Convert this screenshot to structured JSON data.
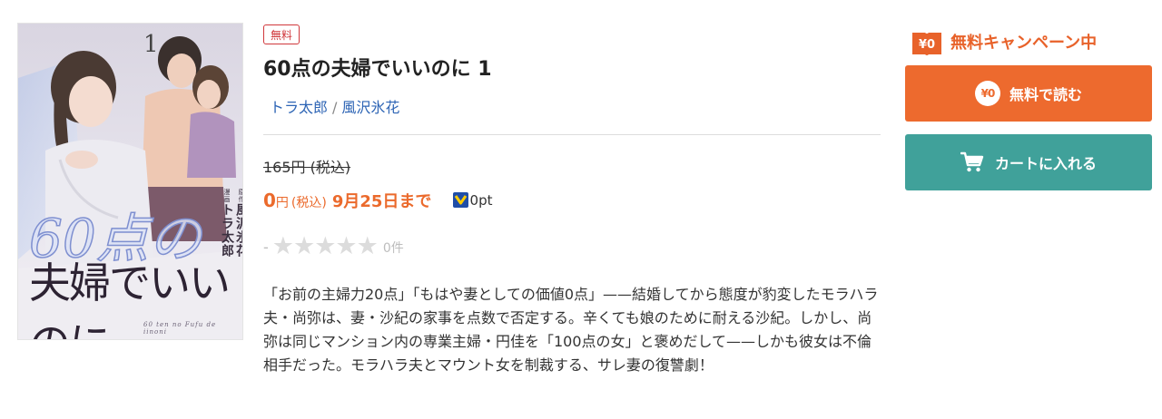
{
  "cover": {
    "volume": "1",
    "title_number": "60点の",
    "title_main": "夫婦でいいのに",
    "romaji": "60 ten no Fufu de iinoni",
    "credit_original_label": "原作",
    "credit_original": "風沢氷花",
    "credit_art_label": "漫画",
    "credit_art": "トラ太郎"
  },
  "product": {
    "badge": "無料",
    "title": "60点の夫婦でいいのに 1",
    "authors": [
      "トラ太郎",
      "風沢氷花"
    ],
    "author_separator": "/",
    "list_price": "165円 (税込)",
    "sale_price_number": "0",
    "sale_price_unit": "円",
    "sale_tax_label": "(税込)",
    "sale_until": "9月25日まで",
    "points": "0pt",
    "rating_placeholder": "-",
    "rating_stars": 0,
    "rating_count": "0件",
    "description": "「お前の主婦力20点」「もはや妻としての価値0点」——結婚してから態度が豹変したモラハラ夫・尚弥は、妻・沙紀の家事を点数で否定する。辛くても娘のために耐える沙紀。しかし、尚弥は同じマンション内の専業主婦・円佳を「100点の女」と褒めだして——しかも彼女は不倫相手だった。モラハラ夫とマウント女を制裁する、サレ妻の復讐劇！"
  },
  "actions": {
    "campaign_icon_text": "¥0",
    "campaign_label": "無料キャンペーン中",
    "read_free_icon_text": "¥0",
    "read_free_label": "無料で読む",
    "cart_label": "カートに入れる"
  },
  "colors": {
    "accent_orange": "#ed6a2e",
    "cart_teal": "#40a19a",
    "badge_red": "#d0383c",
    "link_blue": "#2e65b5"
  },
  "icons": [
    "yen-book-icon",
    "yen-circle-icon",
    "cart-icon",
    "point-icon",
    "star-icon"
  ]
}
